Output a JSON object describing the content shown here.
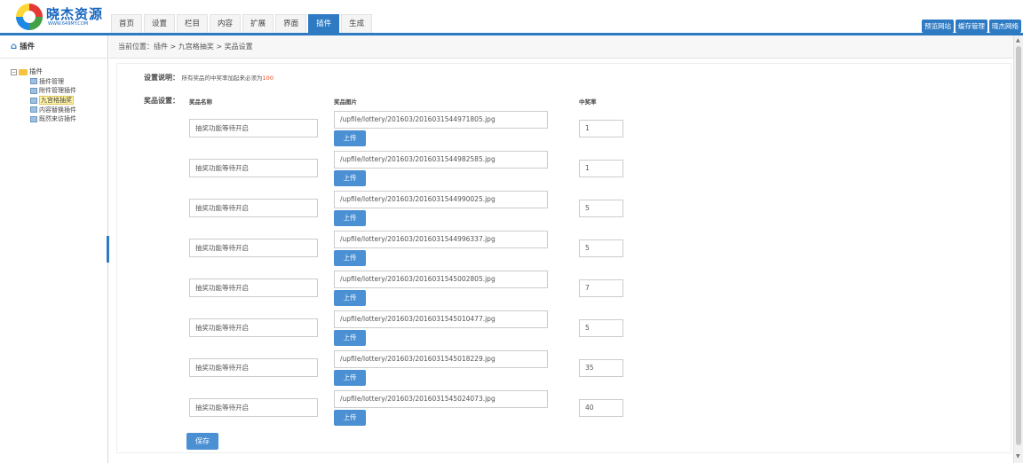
{
  "logo": {
    "text": "晓杰资源",
    "sub": "WWW.649MY.COM"
  },
  "nav": [
    "首页",
    "设置",
    "栏目",
    "内容",
    "扩展",
    "界面",
    "插件",
    "生成"
  ],
  "nav_active_index": 6,
  "right_buttons": [
    "预览网站",
    "缓存管理",
    "晓杰网络"
  ],
  "sidebar": {
    "title": "插件",
    "root": "插件",
    "items": [
      "插件管理",
      "附件管理插件",
      "九宫格抽奖",
      "内容替换插件",
      "既然来访插件"
    ],
    "active_index": 2
  },
  "breadcrumb": "当前位置：插件 > 九宫格抽奖 > 奖品设置",
  "description": {
    "label": "设置说明：",
    "text": "所有奖品的中奖率加起来必须为",
    "value": "100"
  },
  "settings_label": "奖品设置：",
  "columns": {
    "name": "奖品名称",
    "image": "奖品图片",
    "rate": "中奖率"
  },
  "upload_label": "上传",
  "save_label": "保存",
  "prizes": [
    {
      "name": "抽奖功能等待开启",
      "image": "/upfile/lottery/201603/2016031544971805.jpg",
      "rate": "1"
    },
    {
      "name": "抽奖功能等待开启",
      "image": "/upfile/lottery/201603/2016031544982585.jpg",
      "rate": "1"
    },
    {
      "name": "抽奖功能等待开启",
      "image": "/upfile/lottery/201603/2016031544990025.jpg",
      "rate": "5"
    },
    {
      "name": "抽奖功能等待开启",
      "image": "/upfile/lottery/201603/2016031544996337.jpg",
      "rate": "5"
    },
    {
      "name": "抽奖功能等待开启",
      "image": "/upfile/lottery/201603/2016031545002805.jpg",
      "rate": "7"
    },
    {
      "name": "抽奖功能等待开启",
      "image": "/upfile/lottery/201603/2016031545010477.jpg",
      "rate": "5"
    },
    {
      "name": "抽奖功能等待开启",
      "image": "/upfile/lottery/201603/2016031545018229.jpg",
      "rate": "35"
    },
    {
      "name": "抽奖功能等待开启",
      "image": "/upfile/lottery/201603/2016031545024073.jpg",
      "rate": "40"
    }
  ],
  "colors": {
    "accent": "#2e7bc4",
    "button": "#4a90d2",
    "highlight": "#e64a19"
  }
}
